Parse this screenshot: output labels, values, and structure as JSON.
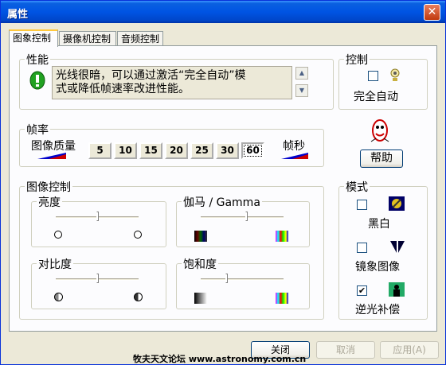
{
  "window": {
    "title": "属性",
    "close_glyph": "✕"
  },
  "tabs": [
    {
      "label": "图象控制",
      "active": true
    },
    {
      "label": "摄像机控制",
      "active": false
    },
    {
      "label": "音频控制",
      "active": false
    }
  ],
  "performance": {
    "label": "性能",
    "message_line1": "光线很暗，可以通过激活“完全自动”模",
    "message_line2": "式或降低帧速率改进性能。"
  },
  "control": {
    "label": "控制",
    "auto_label": "完全自动",
    "auto_checked": false
  },
  "framerate": {
    "label": "帧率",
    "quality_label": "图像质量",
    "fps_label": "帧秒",
    "options": [
      "5",
      "10",
      "15",
      "20",
      "25",
      "30",
      "60"
    ],
    "selected": "60"
  },
  "help": {
    "label": "帮助"
  },
  "image_control": {
    "label": "图像控制",
    "brightness": {
      "label": "亮度",
      "value": 0.5
    },
    "gamma": {
      "label": "伽马 / Gamma",
      "value": 0.55
    },
    "contrast": {
      "label": "对比度",
      "value": 0.5
    },
    "saturation": {
      "label": "饱和度",
      "value": 0.3
    }
  },
  "mode": {
    "label": "模式",
    "bw": {
      "label": "黑白",
      "checked": false
    },
    "mirror": {
      "label": "镜象图像",
      "checked": false
    },
    "backlight": {
      "label": "逆光补偿",
      "checked": true,
      "check_glyph": "✔"
    }
  },
  "footer": {
    "close_label": "关闭",
    "cancel_label": "取消",
    "apply_label": "应用(A)",
    "watermark": "牧夫天文论坛 www.astronomy.com.cn"
  }
}
